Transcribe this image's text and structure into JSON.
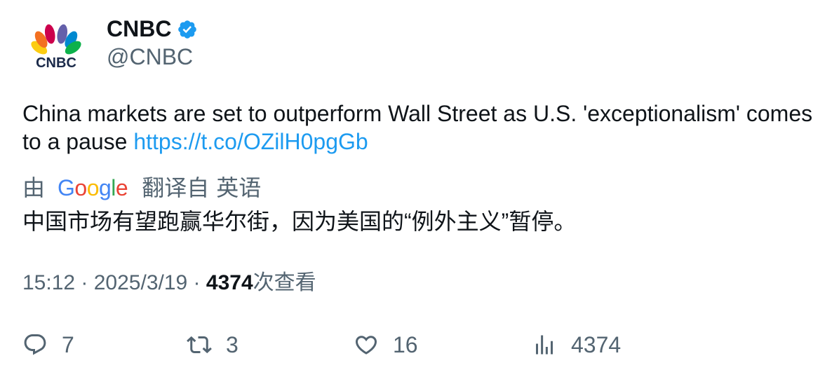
{
  "author": {
    "display_name": "CNBC",
    "handle": "@CNBC",
    "avatar_text": "CNBC",
    "verified": true,
    "verified_color": "#1d9bf0"
  },
  "tweet": {
    "text": "China markets are set to outperform Wall Street as U.S. 'exceptionalism' comes to a pause",
    "link": "https://t.co/OZilH0pgGb",
    "link_color": "#1d9bf0"
  },
  "translation": {
    "by_label": "由",
    "provider": "Google",
    "from_label": "翻译自",
    "source_language": "英语",
    "text": "中国市场有望跑赢华尔街，因为美国的“例外主义”暂停。"
  },
  "meta": {
    "time": "15:12",
    "separator": " · ",
    "date": "2025/3/19",
    "views_count": "4374",
    "views_label": "次查看"
  },
  "actions": {
    "reply": {
      "icon": "reply-icon",
      "count": "7"
    },
    "retweet": {
      "icon": "retweet-icon",
      "count": "3"
    },
    "like": {
      "icon": "heart-icon",
      "count": "16"
    },
    "views": {
      "icon": "analytics-icon",
      "count": "4374"
    }
  },
  "colors": {
    "text_primary": "#0f1419",
    "text_secondary": "#536471",
    "accent": "#1d9bf0"
  }
}
